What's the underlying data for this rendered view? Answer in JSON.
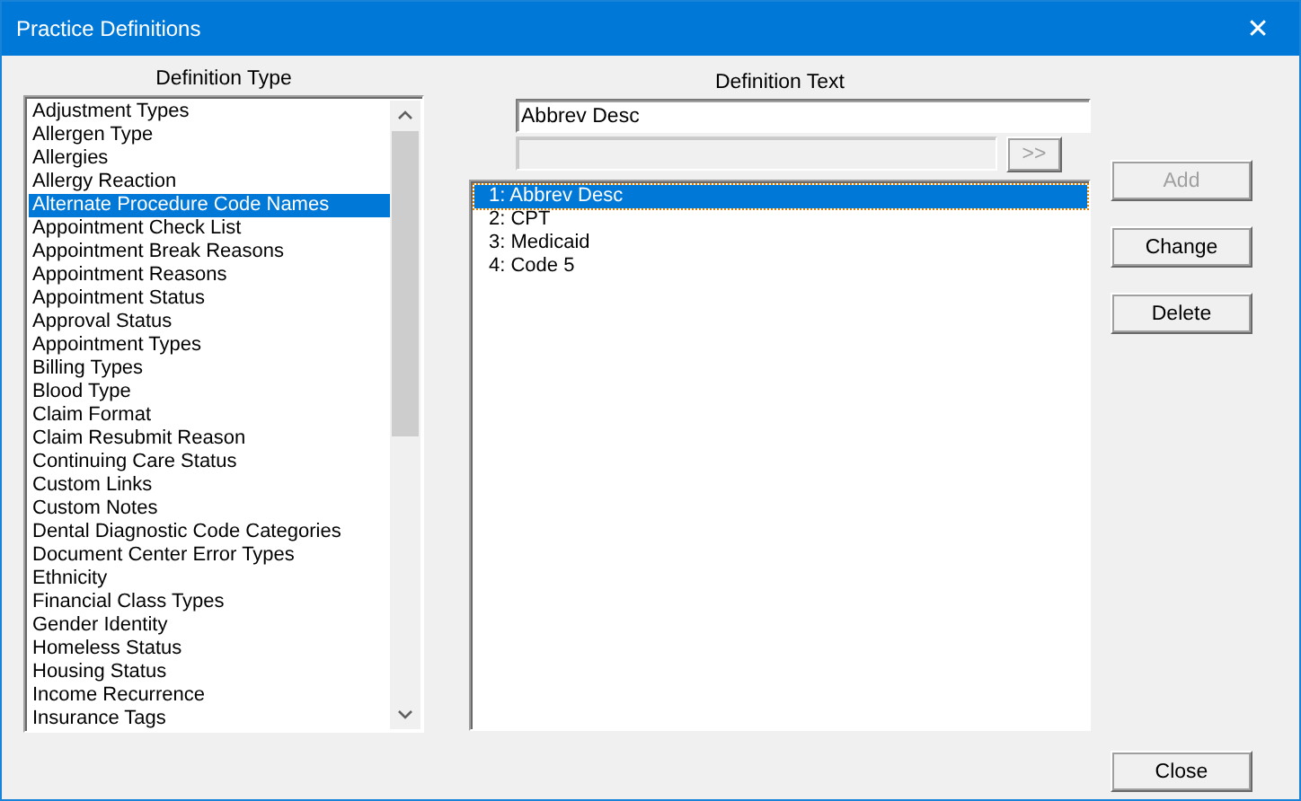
{
  "window": {
    "title": "Practice Definitions",
    "close": "✕"
  },
  "definition_type": {
    "label": "Definition Type",
    "items": [
      {
        "label": "Adjustment Types",
        "selected": false
      },
      {
        "label": "Allergen Type",
        "selected": false
      },
      {
        "label": "Allergies",
        "selected": false
      },
      {
        "label": "Allergy Reaction",
        "selected": false
      },
      {
        "label": "Alternate Procedure Code Names",
        "selected": true
      },
      {
        "label": "Appointment Check List",
        "selected": false
      },
      {
        "label": "Appointment Break Reasons",
        "selected": false
      },
      {
        "label": "Appointment Reasons",
        "selected": false
      },
      {
        "label": "Appointment Status",
        "selected": false
      },
      {
        "label": "Approval Status",
        "selected": false
      },
      {
        "label": "Appointment Types",
        "selected": false
      },
      {
        "label": "Billing Types",
        "selected": false
      },
      {
        "label": "Blood Type",
        "selected": false
      },
      {
        "label": "Claim Format",
        "selected": false
      },
      {
        "label": "Claim Resubmit Reason",
        "selected": false
      },
      {
        "label": "Continuing Care Status",
        "selected": false
      },
      {
        "label": "Custom Links",
        "selected": false
      },
      {
        "label": "Custom Notes",
        "selected": false
      },
      {
        "label": "Dental Diagnostic Code Categories",
        "selected": false
      },
      {
        "label": "Document Center Error Types",
        "selected": false
      },
      {
        "label": "Ethnicity",
        "selected": false
      },
      {
        "label": "Financial Class Types",
        "selected": false
      },
      {
        "label": "Gender Identity",
        "selected": false
      },
      {
        "label": "Homeless Status",
        "selected": false
      },
      {
        "label": "Housing Status",
        "selected": false
      },
      {
        "label": "Income Recurrence",
        "selected": false
      },
      {
        "label": "Insurance Tags",
        "selected": false
      }
    ]
  },
  "definition_text": {
    "label": "Definition Text",
    "value": "Abbrev Desc",
    "secondary_field": {
      "disabled": true
    },
    "move_button": {
      "label": ">>",
      "disabled": true
    },
    "items": [
      {
        "label": "1: Abbrev Desc",
        "selected": true
      },
      {
        "label": "2: CPT",
        "selected": false
      },
      {
        "label": "3: Medicaid",
        "selected": false
      },
      {
        "label": "4: Code 5",
        "selected": false
      }
    ]
  },
  "buttons": [
    {
      "label": "Add",
      "disabled": true
    },
    {
      "label": "Change",
      "disabled": false
    },
    {
      "label": "Delete",
      "disabled": false
    }
  ],
  "footer_button": {
    "label": "Close",
    "disabled": false
  }
}
